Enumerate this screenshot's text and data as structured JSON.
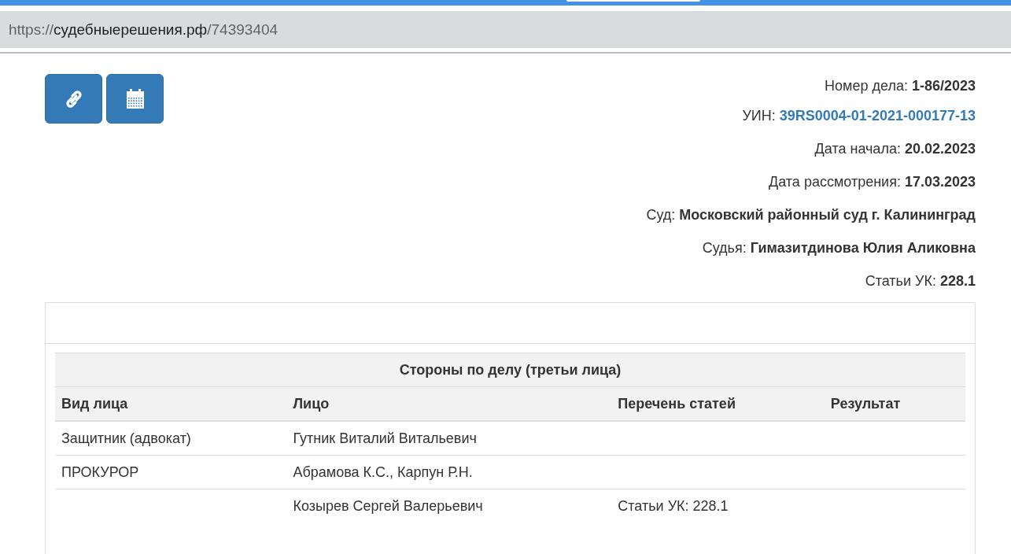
{
  "address_bar": {
    "scheme": "https://",
    "host": "судебныерешения.рф",
    "path": "/74393404"
  },
  "toolbar": [
    {
      "kind": "link"
    },
    {
      "kind": "calendar"
    }
  ],
  "case_info": [
    {
      "label": "Номер дела:",
      "value": "1-86/2023",
      "kind": "text"
    },
    {
      "label": "УИН:",
      "value": "39RS0004-01-2021-000177-13",
      "kind": "link"
    },
    {
      "label": "Дата начала:",
      "value": "20.02.2023",
      "kind": "text"
    },
    {
      "label": "Дата рассмотрения:",
      "value": "17.03.2023",
      "kind": "text"
    },
    {
      "label": "Суд:",
      "value": "Московский районный суд г. Калининград",
      "kind": "text"
    },
    {
      "label": "Судья:",
      "value": "Гимазитдинова Юлия Аликовна",
      "kind": "text"
    },
    {
      "label": "Статьи УК:",
      "value": "228.1",
      "kind": "text"
    }
  ],
  "parties_table": {
    "title": "Стороны по делу (третьи лица)",
    "columns": [
      "Вид лица",
      "Лицо",
      "Перечень статей",
      "Результат"
    ],
    "rows": [
      [
        "Защитник (адвокат)",
        "Гутник Виталий Витальевич",
        "",
        ""
      ],
      [
        "ПРОКУРОР",
        "Абрамова К.С., Карпун Р.Н.",
        "",
        ""
      ],
      [
        "",
        "Козырев Сергей Валерьевич",
        "Статьи УК: 228.1",
        ""
      ]
    ]
  }
}
